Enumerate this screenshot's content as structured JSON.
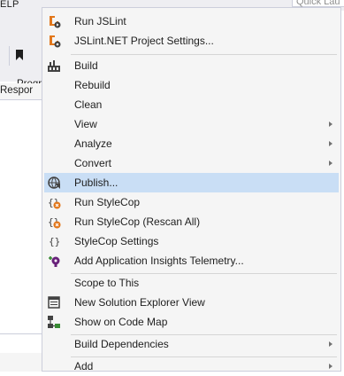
{
  "background": {
    "menu_fragment": "ELP",
    "quick_launch_placeholder": "Quick Lau",
    "toolbar_label": "Progr",
    "doc_tab_label": "Respor"
  },
  "context_menu": {
    "items": [
      {
        "label": "Run JSLint",
        "icon": "jslint-run-icon",
        "submenu": false
      },
      {
        "label": "JSLint.NET Project Settings...",
        "icon": "jslint-settings-icon",
        "submenu": false
      },
      {
        "label": "Build",
        "icon": "build-icon",
        "submenu": false
      },
      {
        "label": "Rebuild",
        "icon": "",
        "submenu": false
      },
      {
        "label": "Clean",
        "icon": "",
        "submenu": false
      },
      {
        "label": "View",
        "icon": "",
        "submenu": true
      },
      {
        "label": "Analyze",
        "icon": "",
        "submenu": true
      },
      {
        "label": "Convert",
        "icon": "",
        "submenu": true
      },
      {
        "label": "Publish...",
        "icon": "publish-icon",
        "submenu": false,
        "selected": true
      },
      {
        "label": "Run StyleCop",
        "icon": "stylecop-run-icon",
        "submenu": false
      },
      {
        "label": "Run StyleCop (Rescan All)",
        "icon": "stylecop-rescan-icon",
        "submenu": false
      },
      {
        "label": "StyleCop Settings",
        "icon": "stylecop-settings-icon",
        "submenu": false
      },
      {
        "label": "Add Application Insights Telemetry...",
        "icon": "app-insights-icon",
        "submenu": false
      },
      {
        "label": "Scope to This",
        "icon": "",
        "submenu": false
      },
      {
        "label": "New Solution Explorer View",
        "icon": "new-solution-view-icon",
        "submenu": false
      },
      {
        "label": "Show on Code Map",
        "icon": "code-map-icon",
        "submenu": false
      },
      {
        "label": "Build Dependencies",
        "icon": "",
        "submenu": true
      },
      {
        "label": "Add",
        "icon": "",
        "submenu": true
      }
    ]
  },
  "colors": {
    "menu_background": "#f5f5f5",
    "selected_background": "#c9def5",
    "icon_orange": "#e2771b",
    "icon_dark": "#424242",
    "icon_purple": "#68217a"
  }
}
